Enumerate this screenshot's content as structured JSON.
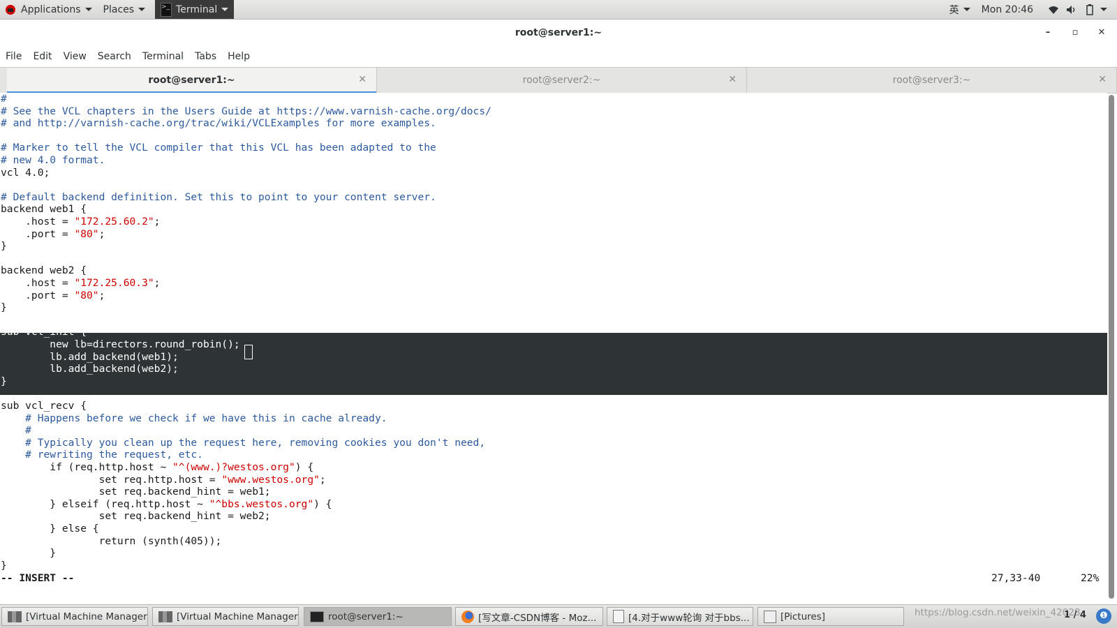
{
  "top_panel": {
    "applications": "Applications",
    "places": "Places",
    "terminal": "Terminal",
    "input_method": "英",
    "clock": "Mon 20:46",
    "icons": [
      "wifi-icon",
      "volume-icon",
      "battery-icon"
    ]
  },
  "window": {
    "title": "root@server1:~",
    "controls": {
      "minimize": "–",
      "maximize": "▫",
      "close": "✕"
    }
  },
  "menu": [
    "File",
    "Edit",
    "View",
    "Search",
    "Terminal",
    "Tabs",
    "Help"
  ],
  "tabs": [
    {
      "label": "root@server1:~",
      "active": true
    },
    {
      "label": "root@server2:~",
      "active": false
    },
    {
      "label": "root@server3:~",
      "active": false
    }
  ],
  "terminal": {
    "lines": [
      "#",
      "# See the VCL chapters in the Users Guide at https://www.varnish-cache.org/docs/",
      "# and http://varnish-cache.org/trac/wiki/VCLExamples for more examples.",
      "",
      "# Marker to tell the VCL compiler that this VCL has been adapted to the",
      "# new 4.0 format.",
      "vcl 4.0;",
      "",
      "# Default backend definition. Set this to point to your content server.",
      "backend web1 {",
      "    .host = \"172.25.60.2\";",
      "    .port = \"80\";",
      "}",
      "",
      "backend web2 {",
      "    .host = \"172.25.60.3\";",
      "    .port = \"80\";",
      "}",
      "",
      "sub vcl_init {",
      "        new lb=directors.round_robin();",
      "        lb.add_backend(web1);",
      "        lb.add_backend(web2);",
      "}",
      "",
      "sub vcl_recv {",
      "    # Happens before we check if we have this in cache already.",
      "    #",
      "    # Typically you clean up the request here, removing cookies you don't need,",
      "    # rewriting the request, etc.",
      "        if (req.http.host ~ \"^(www.)?westos.org\") {",
      "                set req.http.host = \"www.westos.org\";",
      "                set req.backend_hint = web1;",
      "        } elseif (req.http.host ~ \"^bbs.westos.org\") {",
      "                set req.backend_hint = web2;",
      "        } else {",
      "                return (synth(405));",
      "        }",
      "}"
    ],
    "mode": "-- INSERT --",
    "position": "27,33-40",
    "percent": "22%",
    "comment_color": "#2d5a9e",
    "string_color": "#cc0000",
    "selection_color": "#2e3436"
  },
  "taskbar": {
    "items": [
      {
        "label": "[Virtual Machine Manager]",
        "icon": "vmm-icon"
      },
      {
        "label": "[Virtual Machine Manager]",
        "icon": "vmm-icon"
      },
      {
        "label": "root@server1:~",
        "icon": "terminal-icon"
      },
      {
        "label": "[写文章-CSDN博客 - Moz...",
        "icon": "firefox-icon"
      },
      {
        "label": "[4.对于www轮询 对于bbs...",
        "icon": "document-icon"
      },
      {
        "label": "[Pictures]",
        "icon": "folder-icon"
      }
    ],
    "watermark": "https://blog.csdn.net/weixin_42028",
    "page_indicator": "1 / 4",
    "workspace_label": "❶"
  }
}
